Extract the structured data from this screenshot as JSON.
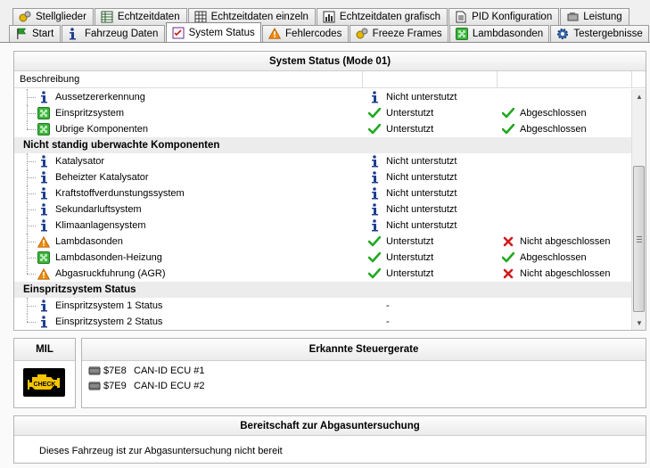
{
  "tabs_row1": [
    {
      "label": "Stellglieder",
      "icon": "gears-icon"
    },
    {
      "label": "Echtzeitdaten",
      "icon": "table-icon"
    },
    {
      "label": "Echtzeitdaten einzeln",
      "icon": "table-grid-icon"
    },
    {
      "label": "Echtzeitdaten grafisch",
      "icon": "bar-chart-icon"
    },
    {
      "label": "PID Konfiguration",
      "icon": "document-icon"
    },
    {
      "label": "Leistung",
      "icon": "engine-icon"
    }
  ],
  "tabs_row2": [
    {
      "label": "Start",
      "icon": "flag-icon"
    },
    {
      "label": "Fahrzeug Daten",
      "icon": "info-icon"
    },
    {
      "label": "System Status",
      "icon": "checklist-icon",
      "active": true
    },
    {
      "label": "Fehlercodes",
      "icon": "warning-icon"
    },
    {
      "label": "Freeze Frames",
      "icon": "gears-icon"
    },
    {
      "label": "Lambdasonden",
      "icon": "puzzle-icon"
    },
    {
      "label": "Testergebnisse",
      "icon": "gear-icon"
    }
  ],
  "main": {
    "title": "System Status (Mode 01)",
    "column_header": "Beschreibung",
    "rows": [
      {
        "type": "item",
        "name": "Aussetzererkennung",
        "icon": "info",
        "support_icon": "info",
        "support": "Nicht unterstutzt",
        "done_icon": "",
        "done": ""
      },
      {
        "type": "item",
        "name": "Einspritzsystem",
        "icon": "puzzle",
        "support_icon": "check",
        "support": "Unterstutzt",
        "done_icon": "check",
        "done": "Abgeschlossen"
      },
      {
        "type": "item",
        "name": "Ubrige Komponenten",
        "icon": "puzzle",
        "support_icon": "check",
        "support": "Unterstutzt",
        "done_icon": "check",
        "done": "Abgeschlossen",
        "last": true
      },
      {
        "type": "group",
        "name": "Nicht standig uberwachte Komponenten"
      },
      {
        "type": "item",
        "name": "Katalysator",
        "icon": "info",
        "support_icon": "info",
        "support": "Nicht unterstutzt",
        "done_icon": "",
        "done": ""
      },
      {
        "type": "item",
        "name": "Beheizter Katalysator",
        "icon": "info",
        "support_icon": "info",
        "support": "Nicht unterstutzt",
        "done_icon": "",
        "done": ""
      },
      {
        "type": "item",
        "name": "Kraftstoffverdunstungssystem",
        "icon": "info",
        "support_icon": "info",
        "support": "Nicht unterstutzt",
        "done_icon": "",
        "done": ""
      },
      {
        "type": "item",
        "name": "Sekundarluftsystem",
        "icon": "info",
        "support_icon": "info",
        "support": "Nicht unterstutzt",
        "done_icon": "",
        "done": ""
      },
      {
        "type": "item",
        "name": "Klimaanlagensystem",
        "icon": "info",
        "support_icon": "info",
        "support": "Nicht unterstutzt",
        "done_icon": "",
        "done": ""
      },
      {
        "type": "item",
        "name": "Lambdasonden",
        "icon": "warning",
        "support_icon": "check",
        "support": "Unterstutzt",
        "done_icon": "cross",
        "done": "Nicht abgeschlossen"
      },
      {
        "type": "item",
        "name": "Lambdasonden-Heizung",
        "icon": "puzzle",
        "support_icon": "check",
        "support": "Unterstutzt",
        "done_icon": "check",
        "done": "Abgeschlossen"
      },
      {
        "type": "item",
        "name": "Abgasruckfuhrung (AGR)",
        "icon": "warning",
        "support_icon": "check",
        "support": "Unterstutzt",
        "done_icon": "cross",
        "done": "Nicht abgeschlossen",
        "last": true
      },
      {
        "type": "group",
        "name": "Einspritzsystem Status"
      },
      {
        "type": "item",
        "name": "Einspritzsystem 1 Status",
        "icon": "info",
        "support_icon": "",
        "support": "-",
        "done_icon": "",
        "done": ""
      },
      {
        "type": "item",
        "name": "Einspritzsystem 2 Status",
        "icon": "info",
        "support_icon": "",
        "support": "-",
        "done_icon": "",
        "done": "",
        "last": true
      }
    ]
  },
  "mil": {
    "title": "MIL",
    "icon_label": "CHECK"
  },
  "ecu": {
    "title": "Erkannte Steuergerate",
    "items": [
      {
        "addr": "$7E8",
        "label": "CAN-ID ECU #1"
      },
      {
        "addr": "$7E9",
        "label": "CAN-ID ECU #2"
      }
    ]
  },
  "readiness": {
    "title": "Bereitschaft zur Abgasuntersuchung",
    "text": "Dieses Fahrzeug ist zur Abgasuntersuchung nicht bereit"
  },
  "colors": {
    "info": "#1f3f8f",
    "check": "#22a822",
    "cross": "#d11a1a",
    "warning": "#f08a00",
    "puzzle": "#3cb43c",
    "mil_yellow": "#f5c400"
  }
}
